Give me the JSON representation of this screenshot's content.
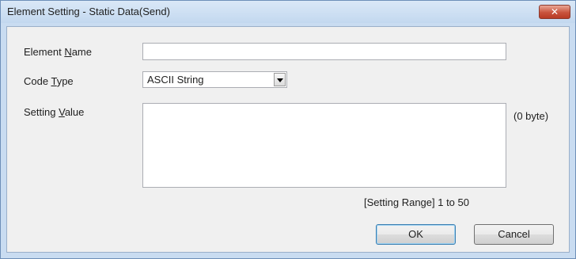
{
  "window": {
    "title": "Element Setting - Static Data(Send)",
    "close_glyph": "✕"
  },
  "form": {
    "element_name": {
      "label_pre": "Element ",
      "label_key": "N",
      "label_post": "ame",
      "value": ""
    },
    "code_type": {
      "label_pre": "Code ",
      "label_key": "T",
      "label_post": "ype",
      "selected": "ASCII String"
    },
    "setting_value": {
      "label_pre": "Setting ",
      "label_key": "V",
      "label_post": "alue",
      "value": "",
      "byte_count": "(0 byte)"
    },
    "setting_range": "[Setting Range] 1 to 50"
  },
  "buttons": {
    "ok": "OK",
    "cancel": "Cancel"
  },
  "colors": {
    "titlebar": "#c9dcf1",
    "client": "#f0f0f0",
    "close": "#c9533d"
  }
}
